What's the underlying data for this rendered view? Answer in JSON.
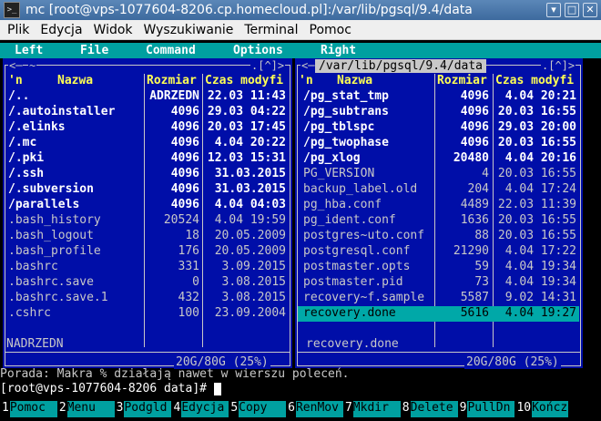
{
  "window": {
    "title": "mc [root@vps-1077604-8206.cp.homecloud.pl]:/var/lib/pgsql/9.4/data",
    "icon": "terminal-icon"
  },
  "menubar": [
    "Plik",
    "Edycja",
    "Widok",
    "Wyszukiwanie",
    "Terminal",
    "Pomoc"
  ],
  "mc_menu": [
    "Left",
    "File",
    "Command",
    "Options",
    "Right"
  ],
  "left_panel": {
    "top_label": "~",
    "corner": ".[^]>",
    "headers": {
      "n": "'n",
      "name": "Nazwa",
      "size": "Rozmiar",
      "time": "Czas modyfi"
    },
    "rows": [
      {
        "name": "/..",
        "size": "ADRZEDN",
        "time": "22.03 11:43",
        "type": "dir"
      },
      {
        "name": "/.autoinstaller",
        "size": "4096",
        "time": "29.03 04:22",
        "type": "dir"
      },
      {
        "name": "/.elinks",
        "size": "4096",
        "time": "20.03 17:45",
        "type": "dir"
      },
      {
        "name": "/.mc",
        "size": "4096",
        "time": "4.04 20:22",
        "type": "dir"
      },
      {
        "name": "/.pki",
        "size": "4096",
        "time": "12.03 15:31",
        "type": "dir"
      },
      {
        "name": "/.ssh",
        "size": "4096",
        "time": "31.03.2015",
        "type": "dir"
      },
      {
        "name": "/.subversion",
        "size": "4096",
        "time": "31.03.2015",
        "type": "dir"
      },
      {
        "name": "/parallels",
        "size": "4096",
        "time": "4.04 04:03",
        "type": "dir"
      },
      {
        "name": " .bash_history",
        "size": "20524",
        "time": "4.04 19:59",
        "type": "file"
      },
      {
        "name": " .bash_logout",
        "size": "18",
        "time": "20.05.2009",
        "type": "file"
      },
      {
        "name": " .bash_profile",
        "size": "176",
        "time": "20.05.2009",
        "type": "file"
      },
      {
        "name": " .bashrc",
        "size": "331",
        "time": "3.09.2015",
        "type": "file"
      },
      {
        "name": " .bashrc.save",
        "size": "0",
        "time": "3.08.2015",
        "type": "file"
      },
      {
        "name": " .bashrc.save.1",
        "size": "432",
        "time": "3.08.2015",
        "type": "file"
      },
      {
        "name": " .cshrc",
        "size": "100",
        "time": "23.09.2004",
        "type": "file"
      }
    ],
    "status": "NADRZEDN",
    "disk": "20G/80G (25%)"
  },
  "right_panel": {
    "path": "/var/lib/pgsql/9.4/data",
    "corner": ".[^]>",
    "headers": {
      "n": "'n",
      "name": "Nazwa",
      "size": "Rozmiar",
      "time": "Czas modyfi"
    },
    "rows": [
      {
        "name": "/pg_stat_tmp",
        "size": "4096",
        "time": "4.04 20:21",
        "type": "dir"
      },
      {
        "name": "/pg_subtrans",
        "size": "4096",
        "time": "20.03 16:55",
        "type": "dir"
      },
      {
        "name": "/pg_tblspc",
        "size": "4096",
        "time": "29.03 20:00",
        "type": "dir"
      },
      {
        "name": "/pg_twophase",
        "size": "4096",
        "time": "20.03 16:55",
        "type": "dir"
      },
      {
        "name": "/pg_xlog",
        "size": "20480",
        "time": "4.04 20:16",
        "type": "dir"
      },
      {
        "name": " PG_VERSION",
        "size": "4",
        "time": "20.03 16:55",
        "type": "file"
      },
      {
        "name": " backup_label.old",
        "size": "204",
        "time": "4.04 17:24",
        "type": "file"
      },
      {
        "name": " pg_hba.conf",
        "size": "4489",
        "time": "22.03 11:39",
        "type": "file"
      },
      {
        "name": " pg_ident.conf",
        "size": "1636",
        "time": "20.03 16:55",
        "type": "file"
      },
      {
        "name": " postgres~uto.conf",
        "size": "88",
        "time": "20.03 16:55",
        "type": "file"
      },
      {
        "name": " postgresql.conf",
        "size": "21290",
        "time": "4.04 17:22",
        "type": "file"
      },
      {
        "name": " postmaster.opts",
        "size": "59",
        "time": "4.04 19:34",
        "type": "file"
      },
      {
        "name": " postmaster.pid",
        "size": "73",
        "time": "4.04 19:34",
        "type": "file"
      },
      {
        "name": " recovery~f.sample",
        "size": "5587",
        "time": "9.02 14:31",
        "type": "file"
      },
      {
        "name": " recovery.done",
        "size": "5616",
        "time": "4.04 19:27",
        "type": "file",
        "selected": true
      }
    ],
    "status": "recovery.done",
    "disk": "20G/80G (25%)"
  },
  "hint": "Porada: Makra % działają nawet w wierszu poleceń.",
  "prompt": "[root@vps-1077604-8206 data]#",
  "fkeys": [
    {
      "num": "1",
      "label": "Pomoc"
    },
    {
      "num": "2",
      "label": "Menu"
    },
    {
      "num": "3",
      "label": "Podgld"
    },
    {
      "num": "4",
      "label": "Edycja"
    },
    {
      "num": "5",
      "label": "Copy"
    },
    {
      "num": "6",
      "label": "RenMov"
    },
    {
      "num": "7",
      "label": "Mkdir"
    },
    {
      "num": "8",
      "label": "Delete"
    },
    {
      "num": "9",
      "label": "PullDn"
    },
    {
      "num": "10",
      "label": "Kończ"
    }
  ],
  "colors": {
    "panel_bg": "#000ea8",
    "accent": "#00a0a0",
    "header_fg": "#ffff54",
    "titlebar": "#4a78ab"
  }
}
